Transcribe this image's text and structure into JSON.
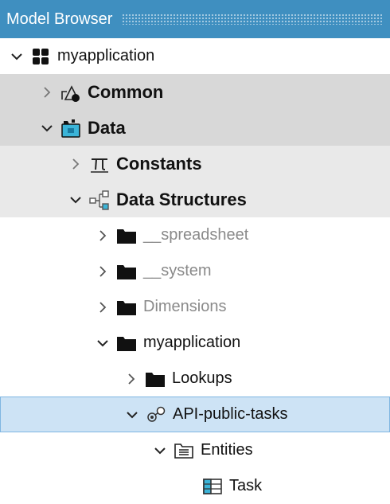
{
  "panel": {
    "title": "Model Browser"
  },
  "tree": {
    "root": {
      "label": "myapplication",
      "icon": "module-grid-icon",
      "state": "expanded"
    },
    "common": {
      "label": "Common",
      "icon": "shapes-icon",
      "state": "collapsed"
    },
    "data": {
      "label": "Data",
      "icon": "data-folder-icon",
      "state": "expanded"
    },
    "constants": {
      "label": "Constants",
      "icon": "pi-icon",
      "state": "collapsed"
    },
    "data_structures": {
      "label": "Data Structures",
      "icon": "hierarchy-icon",
      "state": "expanded"
    },
    "spreadsheet": {
      "label": "__spreadsheet",
      "icon": "folder-icon",
      "state": "collapsed"
    },
    "system": {
      "label": "__system",
      "icon": "folder-icon",
      "state": "collapsed"
    },
    "dimensions": {
      "label": "Dimensions",
      "icon": "folder-icon",
      "state": "collapsed"
    },
    "myapp_folder": {
      "label": "myapplication",
      "icon": "folder-icon",
      "state": "expanded"
    },
    "lookups": {
      "label": "Lookups",
      "icon": "folder-icon",
      "state": "collapsed"
    },
    "api": {
      "label": "API-public-tasks",
      "icon": "api-icon",
      "state": "expanded"
    },
    "entities": {
      "label": "Entities",
      "icon": "entities-folder-icon",
      "state": "expanded"
    },
    "task": {
      "label": "Task",
      "icon": "entity-table-icon"
    }
  },
  "colors": {
    "title_bar": "#3f8fc0",
    "selection_blue": "#cde3f5",
    "selection_grey": "#d8d8d8",
    "accent_cyan": "#3bb4d8"
  }
}
